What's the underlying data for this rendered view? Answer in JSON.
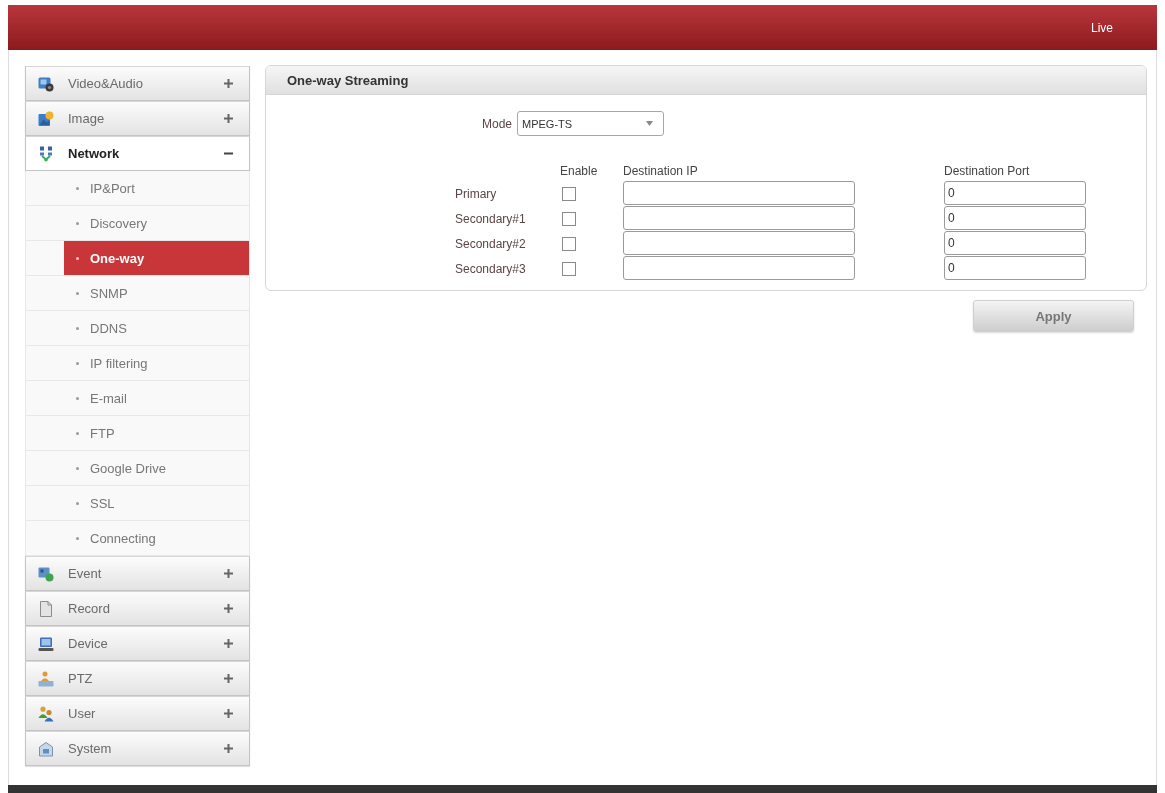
{
  "top_bar": {
    "live_link": "Live"
  },
  "sidebar": {
    "sections": [
      {
        "label": "Video&Audio",
        "expanded": false
      },
      {
        "label": "Image",
        "expanded": false
      },
      {
        "label": "Network",
        "expanded": true,
        "children": [
          {
            "label": "IP&Port",
            "selected": false
          },
          {
            "label": "Discovery",
            "selected": false
          },
          {
            "label": "One-way",
            "selected": true
          },
          {
            "label": "SNMP",
            "selected": false
          },
          {
            "label": "DDNS",
            "selected": false
          },
          {
            "label": "IP filtering",
            "selected": false
          },
          {
            "label": "E-mail",
            "selected": false
          },
          {
            "label": "FTP",
            "selected": false
          },
          {
            "label": "Google Drive",
            "selected": false
          },
          {
            "label": "SSL",
            "selected": false
          },
          {
            "label": "Connecting",
            "selected": false
          }
        ]
      },
      {
        "label": "Event",
        "expanded": false
      },
      {
        "label": "Record",
        "expanded": false
      },
      {
        "label": "Device",
        "expanded": false
      },
      {
        "label": "PTZ",
        "expanded": false
      },
      {
        "label": "User",
        "expanded": false
      },
      {
        "label": "System",
        "expanded": false
      }
    ]
  },
  "panel": {
    "title": "One-way Streaming",
    "mode": {
      "label": "Mode",
      "value": "MPEG-TS"
    },
    "columns": [
      "Enable",
      "Destination IP",
      "Destination Port"
    ],
    "rows": [
      {
        "label": "Primary",
        "checked": false,
        "port": "0"
      },
      {
        "label": "Secondary#1",
        "checked": false,
        "port": "0"
      },
      {
        "label": "Secondary#2",
        "checked": false,
        "port": "0"
      },
      {
        "label": "Secondary#3",
        "checked": false,
        "port": "0"
      }
    ]
  },
  "apply_button": "Apply"
}
